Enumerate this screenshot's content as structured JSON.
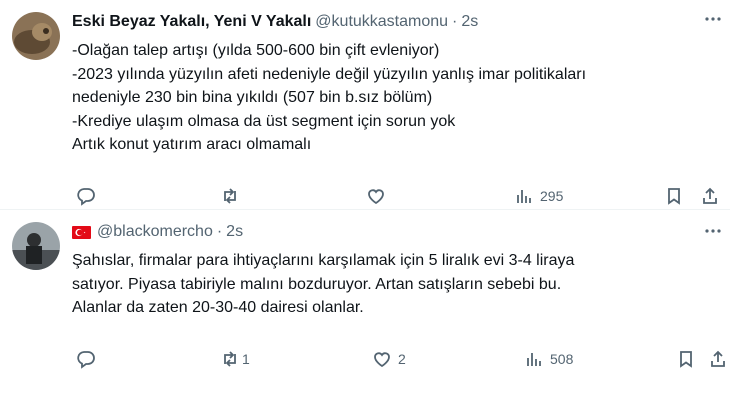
{
  "tweets": [
    {
      "name": "Eski Beyaz Yakalı, Yeni V Yakalı",
      "handle": "@kutukkastamonu",
      "dot": "·",
      "time": "2s",
      "lines": [
        "-Olağan talep artışı (yılda 500-600 bin çift evleniyor)",
        "-2023 yılında yüzyılın afeti nedeniyle değil yüzyılın yanlış imar politikaları",
        "nedeniyle 230 bin bina yıkıldı (507 bin b.sız bölüm)",
        "-Krediye ulaşım olmasa da üst segment için sorun yok",
        "Artık konut yatırım aracı olmamalı"
      ],
      "views": "295"
    },
    {
      "name": "",
      "handle": "@blackomercho",
      "dot": "·",
      "time": "2s",
      "lines": [
        "Şahıslar, firmalar para ihtiyaçlarını karşılamak için 5 liralık evi 3-4 liraya",
        "satıyor. Piyasa tabiriyle malını bozduruyor. Artan satışların sebebi bu.",
        "Alanlar da zaten 20-30-40 dairesi olanlar."
      ],
      "retweets": "1",
      "likes": "2",
      "views": "508"
    }
  ],
  "colors": {
    "text": "#0f1419",
    "muted": "#536471",
    "flag": "#e30a17"
  },
  "icons": [
    "reply-icon",
    "retweet-icon",
    "like-icon",
    "views-icon",
    "bookmark-icon",
    "share-icon",
    "more-icon"
  ]
}
